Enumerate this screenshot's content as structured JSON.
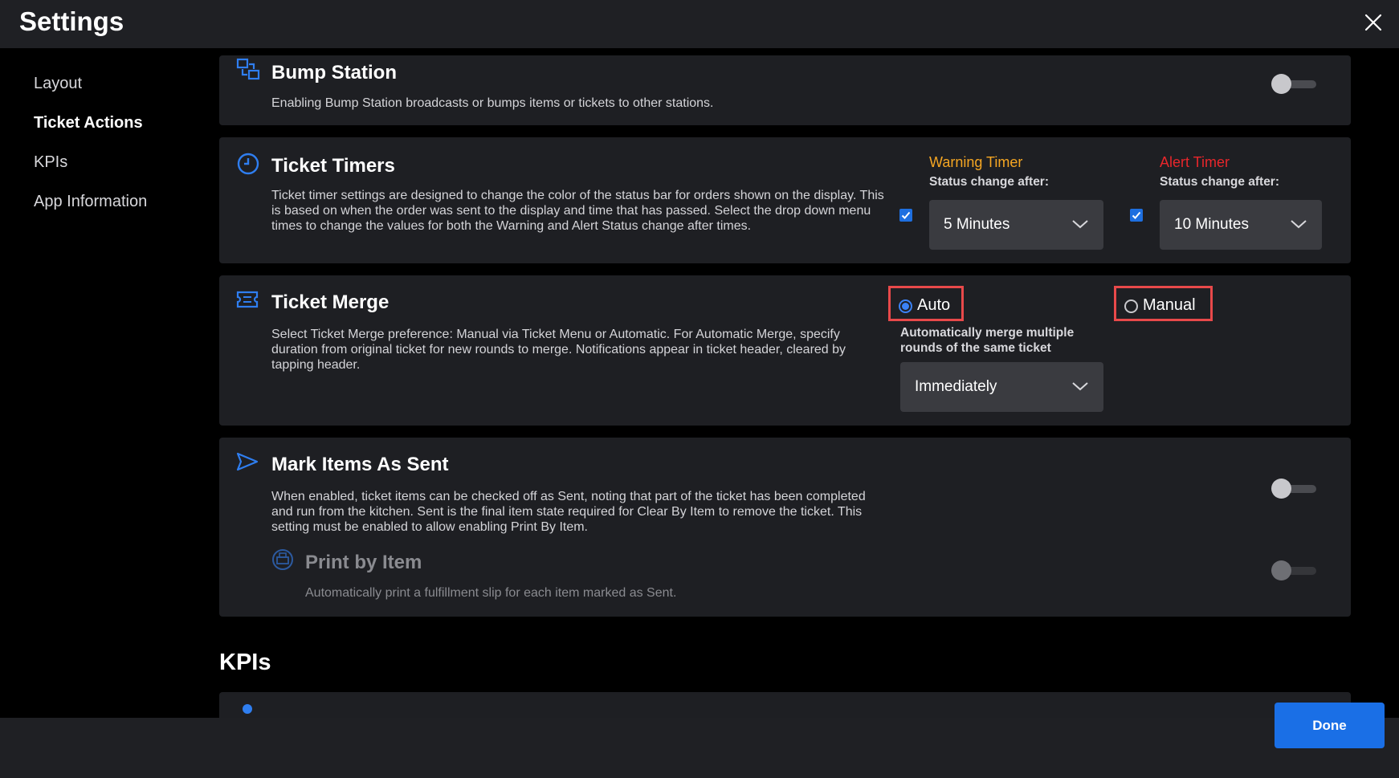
{
  "header": {
    "title": "Settings"
  },
  "sidebar": {
    "items": [
      {
        "label": "Layout"
      },
      {
        "label": "Ticket Actions"
      },
      {
        "label": "KPIs"
      },
      {
        "label": "App Information"
      }
    ]
  },
  "bump_station": {
    "title": "Bump Station",
    "description": "Enabling Bump Station broadcasts or bumps items or tickets to other stations.",
    "enabled": false
  },
  "ticket_timers": {
    "title": "Ticket Timers",
    "description": "Ticket timer settings are designed to change the color of the status bar for orders shown on the display. This is based on when the order was sent to the display and time that has passed. Select the drop down menu times to change the values for both the Warning and Alert Status change after times.",
    "warning": {
      "label": "Warning Timer",
      "status_label": "Status change after:",
      "value": "5 Minutes",
      "checked": true,
      "color": "#f5a623"
    },
    "alert": {
      "label": "Alert Timer",
      "status_label": "Status change after:",
      "value": "10 Minutes",
      "checked": true,
      "color": "#e8262b"
    }
  },
  "ticket_merge": {
    "title": "Ticket Merge",
    "description": "Select Ticket Merge preference: Manual via Ticket Menu or Automatic. For Automatic Merge, specify duration from original ticket for new rounds to merge. Notifications appear in ticket header, cleared by tapping header.",
    "options": {
      "auto": "Auto",
      "manual": "Manual"
    },
    "selected": "Auto",
    "hint": "Automatically merge multiple rounds of the same ticket",
    "duration": "Immediately"
  },
  "mark_items_sent": {
    "title": "Mark Items As Sent",
    "description": "When enabled, ticket items can be checked off as Sent, noting that part of the ticket has been completed and run from the kitchen. Sent is the final item state required for Clear By Item to remove the ticket. This setting must be enabled to allow enabling Print By Item.",
    "enabled": false,
    "print_by_item": {
      "title": "Print by Item",
      "description": "Automatically print a fulfillment slip for each item marked as Sent.",
      "enabled": false
    }
  },
  "kpis": {
    "heading": "KPIs"
  },
  "footer": {
    "done_label": "Done"
  },
  "colors": {
    "accent": "#1a6fe6",
    "highlight_border": "#e8494a",
    "icon_blue": "#2f7ef0"
  }
}
